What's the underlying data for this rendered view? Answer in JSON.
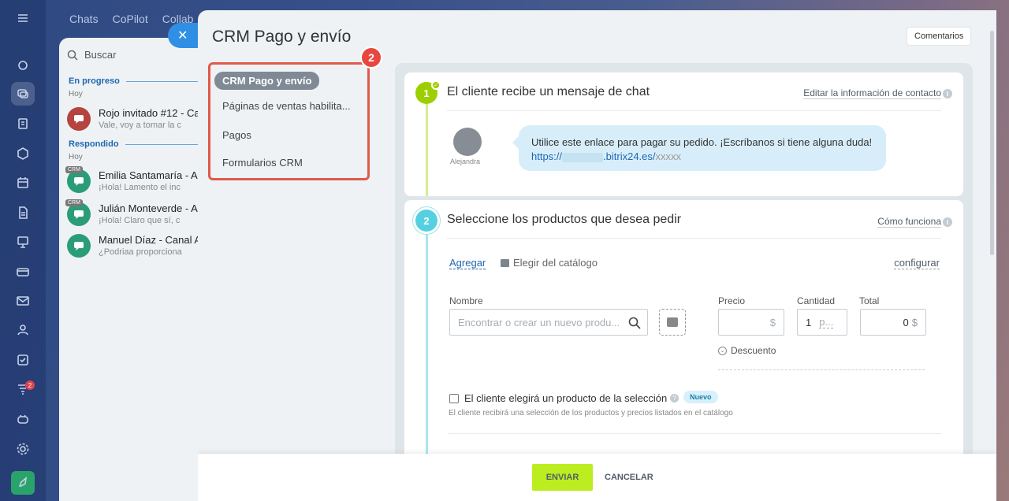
{
  "topnav": [
    "Chats",
    "CoPilot",
    "Collab"
  ],
  "chat_list": {
    "search_label": "Buscar",
    "sections": [
      {
        "title": "En progreso",
        "sub": "Hoy"
      },
      {
        "title": "Respondido",
        "sub": "Hoy"
      }
    ],
    "items": [
      {
        "name": "Rojo invitado #12 - Ca",
        "preview": "Vale, voy a tomar la c",
        "color": "#b5433f",
        "crm": ""
      },
      {
        "name": "Emilia Santamaría - Ac",
        "preview": "¡Hola! Lamento el inc",
        "color": "#2a9d78",
        "crm": "CRM"
      },
      {
        "name": "Julián Monteverde - A",
        "preview": "¡Hola! Claro que sí, c",
        "color": "#2a9d78",
        "crm": "CRM"
      },
      {
        "name": "Manuel Díaz - Canal A",
        "preview": "¿Podriaa proporciona",
        "color": "#2a9d78",
        "crm": ""
      }
    ]
  },
  "rail_badge": "2",
  "slider": {
    "title": "CRM Pago y envío",
    "comments_label": "Comentarios",
    "marker": "2",
    "menu": {
      "active": "CRM Pago y envío",
      "items": [
        "Páginas de ventas habilita...",
        "Pagos",
        "Formularios CRM"
      ]
    },
    "step1": {
      "num": "1",
      "title": "El cliente recibe un mensaje de chat",
      "link": "Editar la información de contacto",
      "avatar_name": "Alejandra",
      "message": "Utilice este enlace para pagar su pedido. ¡Escríbanos si tiene alguna duda!",
      "url_prefix": "https://",
      "url_domain": ".bitrix24.es/",
      "url_suffix": "xxxxx"
    },
    "step2": {
      "num": "2",
      "title": "Seleccione los productos que desea pedir",
      "link": "Cómo funciona",
      "add_label": "Agregar",
      "catalog_label": "Elegir del catálogo",
      "config_label": "configurar",
      "labels": {
        "name": "Nombre",
        "price": "Precio",
        "qty": "Cantidad",
        "total": "Total"
      },
      "name_placeholder": "Encontrar o crear un nuevo produ...",
      "price_unit": "$",
      "qty_value": "1",
      "qty_unit": "p...",
      "total_value": "0",
      "total_unit": "$",
      "discount_label": "Descuento",
      "checkbox_label": "El cliente elegirá un producto de la selección",
      "new_badge": "Nuevo",
      "checkbox_sub": "El cliente recibirá una selección de los productos y precios listados en el catálogo"
    },
    "footer": {
      "send": "ENVIAR",
      "cancel": "CANCELAR"
    }
  }
}
